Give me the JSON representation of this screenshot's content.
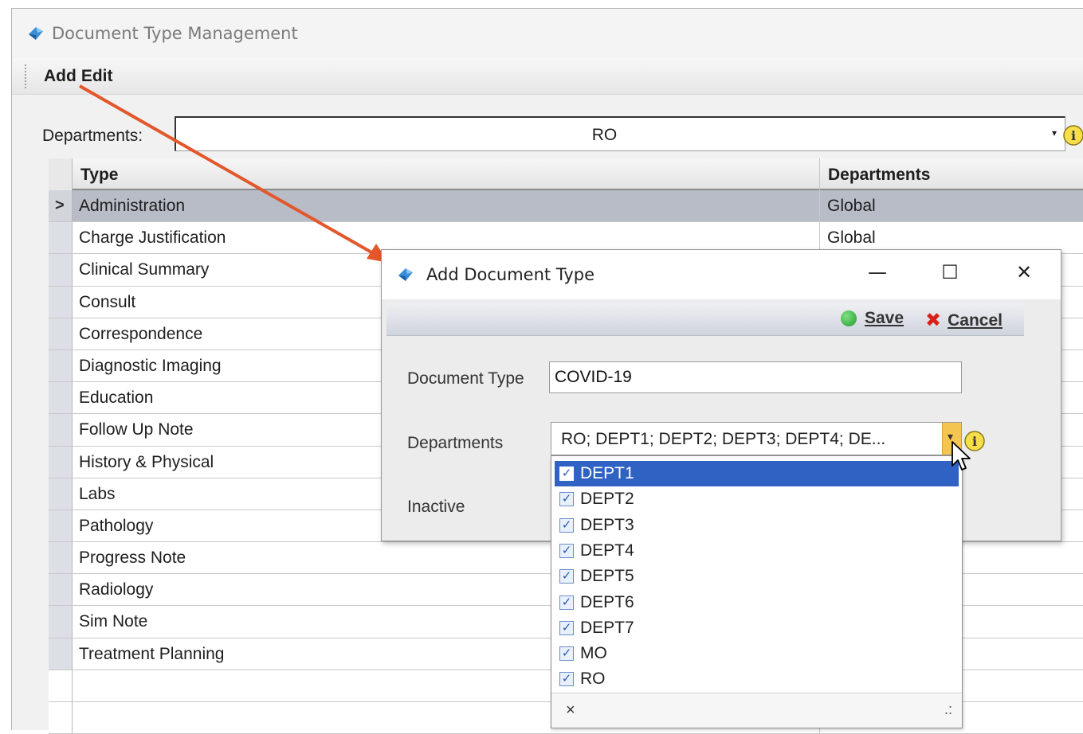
{
  "main": {
    "title": "Document Type Management",
    "menu": {
      "add": "Add",
      "edit": "Edit"
    },
    "departments_label": "Departments:",
    "departments_value": "RO",
    "grid": {
      "headers": {
        "type": "Type",
        "departments": "Departments"
      },
      "rows": [
        {
          "type": "Administration",
          "dept": "Global"
        },
        {
          "type": "Charge Justification",
          "dept": "Global"
        },
        {
          "type": "Clinical Summary",
          "dept": ""
        },
        {
          "type": "Consult",
          "dept": ""
        },
        {
          "type": "Correspondence",
          "dept": ""
        },
        {
          "type": "Diagnostic Imaging",
          "dept": ""
        },
        {
          "type": "Education",
          "dept": ""
        },
        {
          "type": "Follow Up Note",
          "dept": ""
        },
        {
          "type": "History & Physical",
          "dept": ""
        },
        {
          "type": "Labs",
          "dept": ""
        },
        {
          "type": "Pathology",
          "dept": ""
        },
        {
          "type": "Progress Note",
          "dept": ""
        },
        {
          "type": "Radiology",
          "dept": ""
        },
        {
          "type": "Sim Note",
          "dept": ""
        },
        {
          "type": "Treatment Planning",
          "dept": ""
        }
      ],
      "selected_row": 0
    }
  },
  "dialog": {
    "title": "Add Document Type",
    "controls": {
      "minimize": "—",
      "maximize": "☐",
      "close": "✕"
    },
    "toolbar": {
      "save": "Save",
      "cancel": "Cancel"
    },
    "labels": {
      "document_type": "Document Type",
      "departments": "Departments",
      "inactive": "Inactive"
    },
    "document_type_value": "COVID-19",
    "departments_value": "RO; DEPT1; DEPT2; DEPT3; DEPT4; DE..."
  },
  "dropdown": {
    "options": [
      {
        "label": "DEPT1",
        "checked": true,
        "highlighted": true
      },
      {
        "label": "DEPT2",
        "checked": true
      },
      {
        "label": "DEPT3",
        "checked": true
      },
      {
        "label": "DEPT4",
        "checked": true
      },
      {
        "label": "DEPT5",
        "checked": true
      },
      {
        "label": "DEPT6",
        "checked": true
      },
      {
        "label": "DEPT7",
        "checked": true
      },
      {
        "label": "MO",
        "checked": true
      },
      {
        "label": "RO",
        "checked": true
      }
    ],
    "footer_close": "×",
    "footer_grip": ".:"
  },
  "colors": {
    "selection": "#2f62c3",
    "row_selected": "#b7bcc6",
    "annotation_arrow": "#e2572b",
    "save_green": "#1f9b2e",
    "cancel_red": "#d9201a"
  },
  "icons": [
    "app-icon",
    "info-icon",
    "row-pointer-icon",
    "save-icon",
    "cancel-icon",
    "mouse-cursor-icon",
    "annotation-arrow"
  ]
}
